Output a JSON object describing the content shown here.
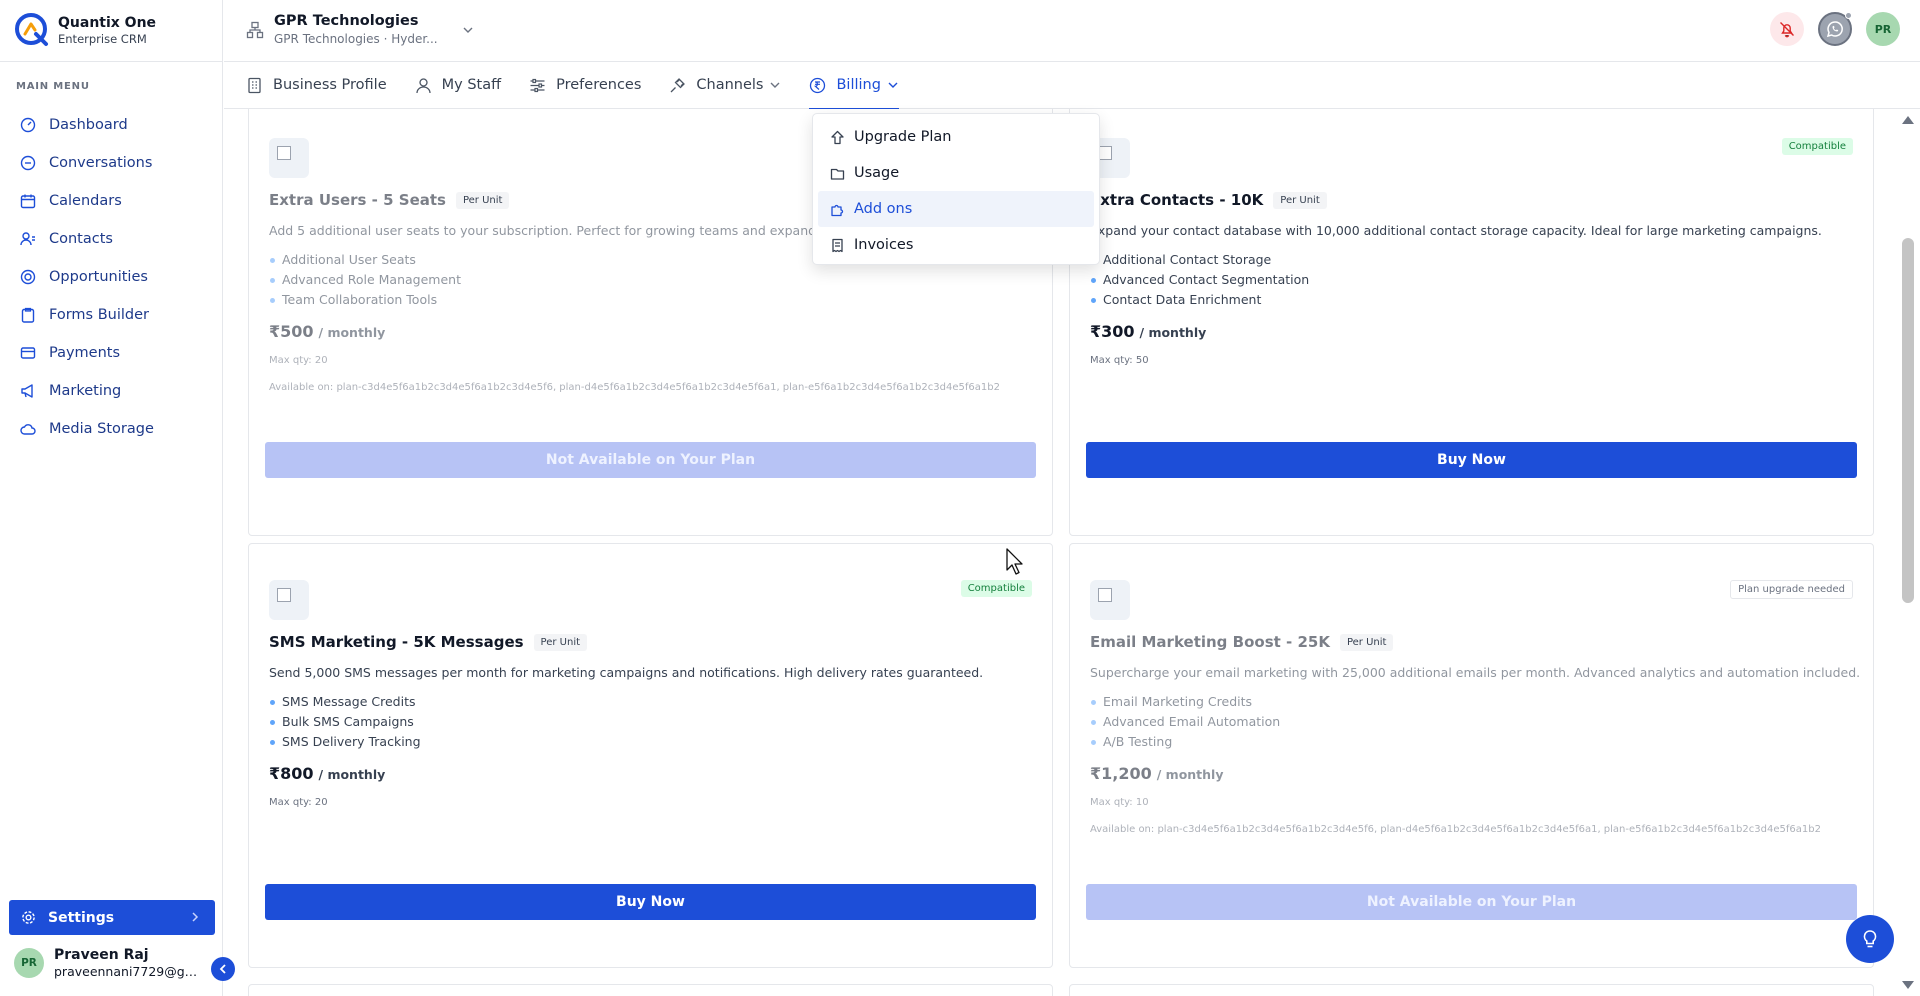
{
  "brand": {
    "name": "Quantix One",
    "subtitle": "Enterprise CRM"
  },
  "sidebar": {
    "section_title": "MAIN MENU",
    "items": [
      {
        "label": "Dashboard",
        "icon": "dashboard-icon"
      },
      {
        "label": "Conversations",
        "icon": "chat-icon"
      },
      {
        "label": "Calendars",
        "icon": "calendar-icon"
      },
      {
        "label": "Contacts",
        "icon": "contacts-icon"
      },
      {
        "label": "Opportunities",
        "icon": "target-icon"
      },
      {
        "label": "Forms Builder",
        "icon": "clipboard-icon"
      },
      {
        "label": "Payments",
        "icon": "credit-card-icon"
      },
      {
        "label": "Marketing",
        "icon": "megaphone-icon"
      },
      {
        "label": "Media Storage",
        "icon": "cloud-icon"
      }
    ],
    "settings_label": "Settings",
    "user": {
      "initials": "PR",
      "name": "Praveen Raj",
      "email": "praveennani7729@gm..."
    }
  },
  "header": {
    "org_name": "GPR Technologies",
    "org_sub": "GPR Technologies · Hyder...",
    "avatar_initials": "PR"
  },
  "tabs": [
    {
      "label": "Business Profile",
      "icon": "building-icon"
    },
    {
      "label": "My Staff",
      "icon": "user-icon"
    },
    {
      "label": "Preferences",
      "icon": "sliders-icon"
    },
    {
      "label": "Channels",
      "icon": "plug-icon"
    },
    {
      "label": "Billing",
      "icon": "rupee-icon"
    }
  ],
  "billing_menu": [
    {
      "label": "Upgrade Plan",
      "icon": "upgrade-icon"
    },
    {
      "label": "Usage",
      "icon": "folder-icon"
    },
    {
      "label": "Add ons",
      "icon": "puzzle-icon"
    },
    {
      "label": "Invoices",
      "icon": "receipt-icon"
    }
  ],
  "cards": [
    {
      "title": "Extra Users - 5 Seats",
      "unit": "Per Unit",
      "badge": "",
      "description": "Add 5 additional user seats to your subscription. Perfect for growing teams and expanding operations.",
      "features": [
        "Additional User Seats",
        "Advanced Role Management",
        "Team Collaboration Tools"
      ],
      "price": "₹500",
      "period": "/ monthly",
      "max_qty": "Max qty: 20",
      "available_on": "Available on: plan-c3d4e5f6a1b2c3d4e5f6a1b2c3d4e5f6, plan-d4e5f6a1b2c3d4e5f6a1b2c3d4e5f6a1, plan-e5f6a1b2c3d4e5f6a1b2c3d4e5f6a1b2",
      "button": "Not Available on Your Plan"
    },
    {
      "title": "Extra Contacts - 10K",
      "unit": "Per Unit",
      "badge": "Compatible",
      "description": "Expand your contact database with 10,000 additional contact storage capacity. Ideal for large marketing campaigns.",
      "features": [
        "Additional Contact Storage",
        "Advanced Contact Segmentation",
        "Contact Data Enrichment"
      ],
      "price": "₹300",
      "period": "/ monthly",
      "max_qty": "Max qty: 50",
      "available_on": "",
      "button": "Buy Now"
    },
    {
      "title": "SMS Marketing - 5K Messages",
      "unit": "Per Unit",
      "badge": "Compatible",
      "description": "Send 5,000 SMS messages per month for marketing campaigns and notifications. High delivery rates guaranteed.",
      "features": [
        "SMS Message Credits",
        "Bulk SMS Campaigns",
        "SMS Delivery Tracking"
      ],
      "price": "₹800",
      "period": "/ monthly",
      "max_qty": "Max qty: 20",
      "available_on": "",
      "button": "Buy Now"
    },
    {
      "title": "Email Marketing Boost - 25K",
      "unit": "Per Unit",
      "badge": "Plan upgrade needed",
      "description": "Supercharge your email marketing with 25,000 additional emails per month. Advanced analytics and automation included.",
      "features": [
        "Email Marketing Credits",
        "Advanced Email Automation",
        "A/B Testing"
      ],
      "price": "₹1,200",
      "period": "/ monthly",
      "max_qty": "Max qty: 10",
      "available_on": "Available on: plan-c3d4e5f6a1b2c3d4e5f6a1b2c3d4e5f6, plan-d4e5f6a1b2c3d4e5f6a1b2c3d4e5f6a1, plan-e5f6a1b2c3d4e5f6a1b2c3d4e5f6a1b2",
      "button": "Not Available on Your Plan"
    }
  ],
  "colors": {
    "accent": "#1d4ed8",
    "compatible": "#15803d",
    "disabled_button": "#b7c3f5"
  }
}
